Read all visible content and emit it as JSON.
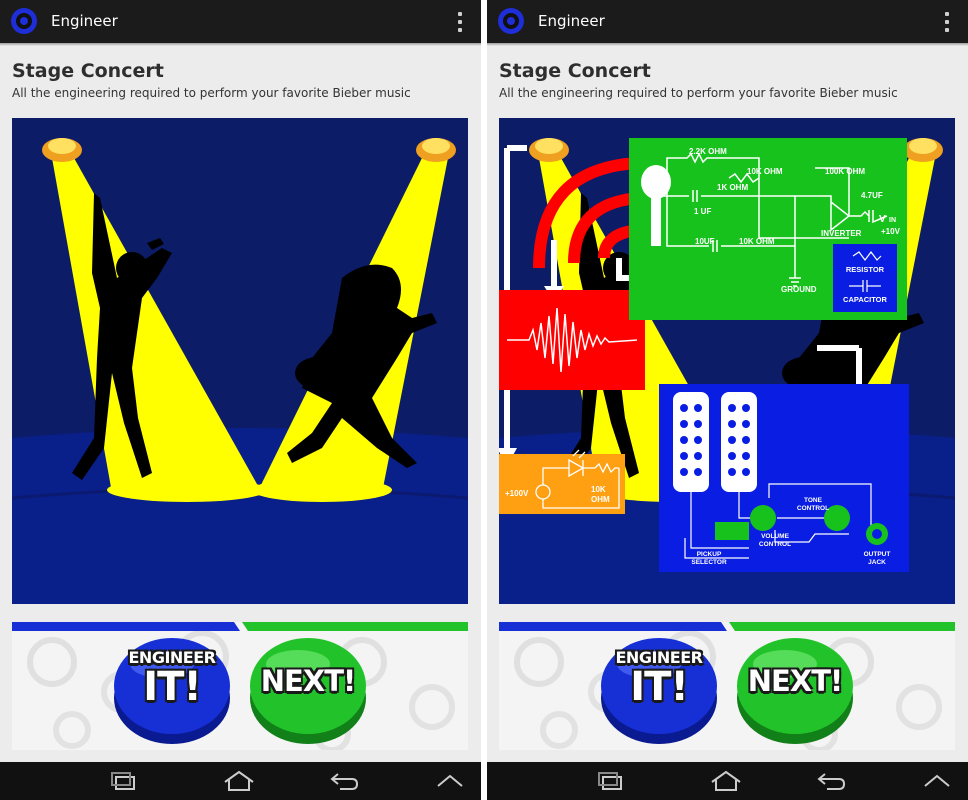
{
  "screens": [
    {
      "app_title": "Engineer",
      "heading": "Stage Concert",
      "subtitle": "All the engineering required to perform your favorite Bieber music",
      "buttons": {
        "engineer_line1": "ENGINEER",
        "engineer_line2": "IT!",
        "next": "NEXT!"
      },
      "overlay_shown": false
    },
    {
      "app_title": "Engineer",
      "heading": "Stage Concert",
      "subtitle": "All the engineering required to perform your favorite Bieber music",
      "buttons": {
        "engineer_line1": "ENGINEER",
        "engineer_line2": "IT!",
        "next": "NEXT!"
      },
      "overlay_shown": true,
      "amp_circuit": {
        "resistor_2k2": "2.2K OHM",
        "resistor_10k_a": "10K OHM",
        "resistor_1k": "1K OHM",
        "resistor_100k": "100K OHM",
        "cap_1uf": "1 UF",
        "cap_10uf": "10UF",
        "resistor_10k_b": "10K OHM",
        "cap_4_7uf": "4.7UF",
        "vin": "V",
        "vin_sub": "IN",
        "plus_10v": "+10V",
        "inverter": "INVERTER",
        "ground": "GROUND",
        "legend_resistor": "RESISTOR",
        "legend_capacitor": "CAPACITOR"
      },
      "led_circuit": {
        "voltage": "+100V",
        "resistor_value": "10K",
        "resistor_unit": "OHM"
      },
      "guitar_circuit": {
        "tone_control_1": "TONE",
        "tone_control_2": "CONTROL",
        "volume_control_1": "VOLUME",
        "volume_control_2": "CONTROL",
        "pickup_selector_1": "PICKUP",
        "pickup_selector_2": "SELECTOR",
        "output_jack_1": "OUTPUT",
        "output_jack_2": "JACK"
      }
    }
  ],
  "icons": {
    "app": "gear-logo-icon",
    "overflow": "overflow-menu-icon",
    "recents": "recent-apps-icon",
    "home": "home-icon",
    "back": "back-icon",
    "menu": "menu-up-icon"
  },
  "colors": {
    "action_bar": "#1b1b1b",
    "stage_sky": "#0c1c67",
    "stage_floor": "#091f8a",
    "spotlight": "#ffff00",
    "button_blue": "#1630d6",
    "button_green": "#22c32a",
    "circuit_green": "#18c21d",
    "circuit_blue": "#0a1ee3",
    "wave_red": "#ff0000",
    "led_orange": "#ffa012"
  }
}
